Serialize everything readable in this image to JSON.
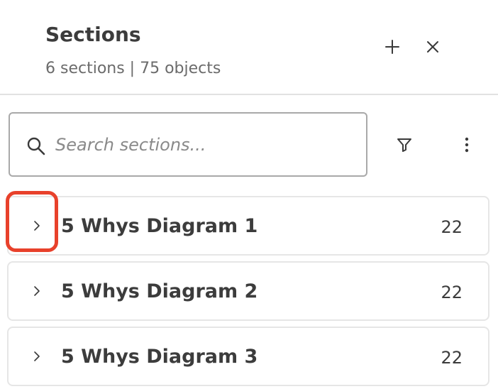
{
  "header": {
    "title": "Sections",
    "subtitle": "6 sections | 75 objects",
    "add_icon": "plus-icon",
    "close_icon": "close-icon"
  },
  "toolbar": {
    "search_placeholder": "Search sections...",
    "search_value": "",
    "search_icon": "search-icon",
    "filter_icon": "filter-icon",
    "more_icon": "more-vertical-icon"
  },
  "sections": [
    {
      "label": "5 Whys Diagram 1",
      "count": "22",
      "expanded": false
    },
    {
      "label": "5 Whys Diagram 2",
      "count": "22",
      "expanded": false
    },
    {
      "label": "5 Whys Diagram 3",
      "count": "22",
      "expanded": false
    }
  ],
  "colors": {
    "highlight": "#e8412b",
    "border": "#e6e6e6",
    "text": "#3c3c3c",
    "muted": "#6b6b6b"
  }
}
